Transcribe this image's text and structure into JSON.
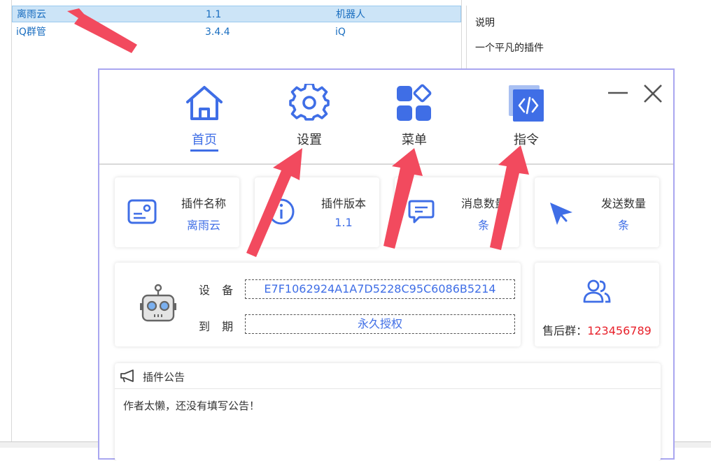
{
  "plugin_list": {
    "rows": [
      {
        "name": "离雨云",
        "version": "1.1",
        "type": "机器人",
        "selected": true
      },
      {
        "name": "iQ群管",
        "version": "3.4.4",
        "type": "iQ",
        "selected": false
      }
    ]
  },
  "description": {
    "heading": "说明",
    "text": "一个平凡的插件"
  },
  "dialog": {
    "nav": [
      {
        "label": "首页",
        "icon": "home-icon",
        "active": true
      },
      {
        "label": "设置",
        "icon": "gear-icon",
        "active": false
      },
      {
        "label": "菜单",
        "icon": "menu-grid-icon",
        "active": false
      },
      {
        "label": "指令",
        "icon": "code-icon",
        "active": false
      }
    ],
    "stats": [
      {
        "title": "插件名称",
        "value": "离雨云",
        "icon": "id-card-icon"
      },
      {
        "title": "插件版本",
        "value": "1.1",
        "icon": "info-icon"
      },
      {
        "title": "消息数量",
        "value": "条",
        "icon": "message-icon"
      },
      {
        "title": "发送数量",
        "value": "条",
        "icon": "send-icon"
      }
    ],
    "device": {
      "device_label": "设 备",
      "device_value": "E7F1062924A1A7D5228C95C6086B5214",
      "expire_label": "到 期",
      "expire_value": "永久授权"
    },
    "support": {
      "label": "售后群：",
      "number": "123456789"
    },
    "notice": {
      "title": "插件公告",
      "content": "作者太懒，还没有填写公告！"
    }
  },
  "colors": {
    "accent": "#3f6ee6",
    "arrow": "#f24a5e",
    "support_number": "#e8202a",
    "list_text": "#1a6ec0"
  }
}
